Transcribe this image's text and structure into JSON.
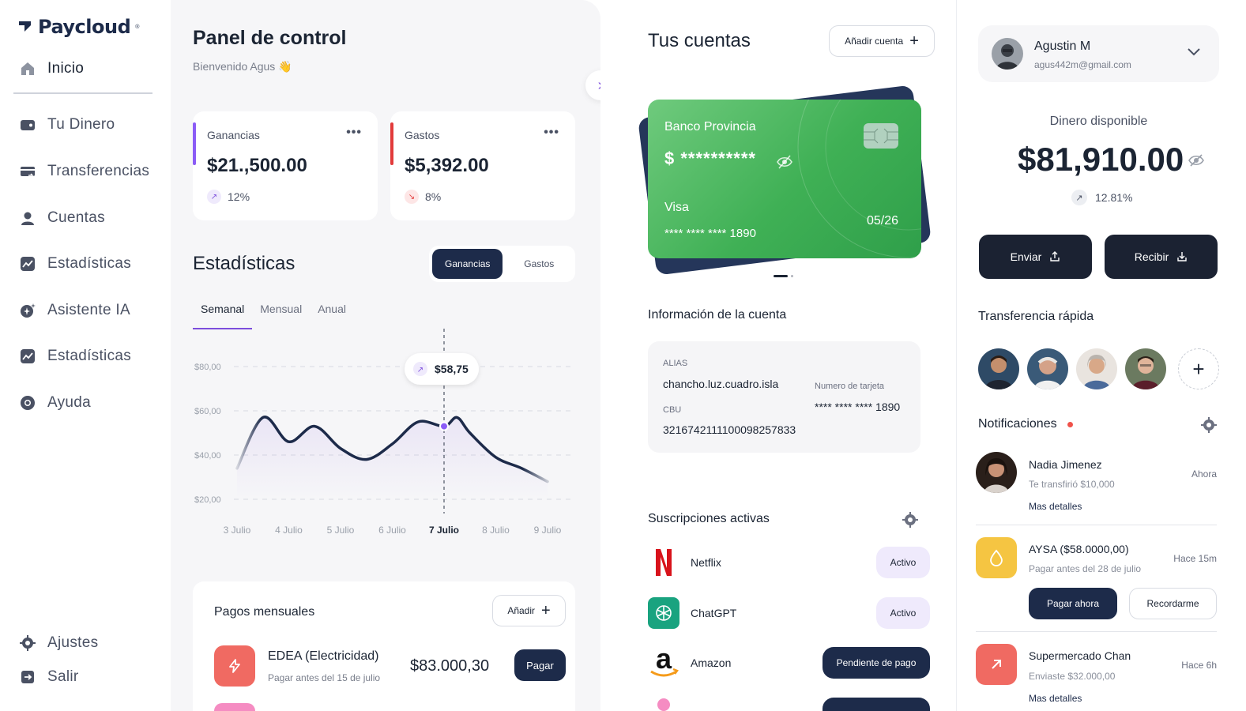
{
  "sidebar": {
    "brand": "Paycloud",
    "brand_mark": "®",
    "items": [
      {
        "label": "Inicio",
        "icon": "home-icon"
      },
      {
        "label": "Tu Dinero",
        "icon": "wallet-icon"
      },
      {
        "label": "Transferencias",
        "icon": "card-transfer-icon"
      },
      {
        "label": "Cuentas",
        "icon": "user-icon"
      },
      {
        "label": "Estadísticas",
        "icon": "chart-icon"
      },
      {
        "label": "Asistente IA",
        "icon": "sparkle-icon"
      },
      {
        "label": "Estadísticas",
        "icon": "chart-icon"
      },
      {
        "label": "Ayuda",
        "icon": "lifebuoy-icon"
      }
    ],
    "settings": "Ajustes",
    "logout": "Salir"
  },
  "dashboard": {
    "title": "Panel de control",
    "subtitle": "Bienvenido Agus 👋",
    "cards": [
      {
        "label": "Ganancias",
        "value": "$21.,500.00",
        "pct": "12%",
        "color": "#8b5cf6"
      },
      {
        "label": "Gastos",
        "value": "$5,392.00",
        "pct": "8%",
        "color": "#e23b3b"
      }
    ],
    "stats_title": "Estadísticas",
    "toggle": {
      "on": "Ganancias",
      "off": "Gastos"
    },
    "tabs": [
      "Semanal",
      "Mensual",
      "Anual"
    ],
    "tooltip": "$58,75"
  },
  "chart_data": {
    "type": "line",
    "categories": [
      "3 Julio",
      "4 Julio",
      "5 Julio",
      "6 Julio",
      "7 Julio",
      "8 Julio",
      "9 Julio"
    ],
    "ytick_labels": [
      "$80,00",
      "$60,00",
      "$40,00",
      "$20,00"
    ],
    "yticks": [
      80,
      60,
      40,
      20
    ],
    "x": [
      0,
      0.5,
      1,
      1.5,
      2,
      2.5,
      3,
      3.5,
      4,
      4.25,
      4.5,
      5,
      5.5,
      6
    ],
    "values": [
      34,
      57,
      46,
      53,
      43,
      38,
      45,
      55,
      53,
      57,
      50,
      39,
      34,
      28
    ],
    "highlight": {
      "category": "7 Julio",
      "value": 58.75
    },
    "ylim": [
      15,
      85
    ],
    "grid": true
  },
  "payments": {
    "title": "Pagos mensuales",
    "add": "Añadir",
    "item": {
      "name": "EDEA (Electricidad)",
      "due": "Pagar antes del 15 de julio",
      "amount": "$83.000,30",
      "action": "Pagar"
    }
  },
  "accounts": {
    "title": "Tus cuentas",
    "add": "Añadir cuenta",
    "card": {
      "bank": "Banco Provincia",
      "hidden": "$ **********",
      "brand": "Visa",
      "number": "**** **** **** 1890",
      "exp": "05/26"
    },
    "info_title": "Información de la cuenta",
    "alias_label": "ALIAS",
    "alias": "chancho.luz.cuadro.isla",
    "cbu_label": "CBU",
    "cbu": "3216742111100098257833",
    "card_label": "Numero de tarjeta",
    "card_number": "**** **** **** 1890",
    "subs_title": "Suscripciones activas",
    "subs": [
      {
        "name": "Netflix",
        "status": "Activo"
      },
      {
        "name": "ChatGPT",
        "status": "Activo"
      },
      {
        "name": "Amazon",
        "status": "Pendiente de pago"
      }
    ]
  },
  "right": {
    "user": {
      "name": "Agustin M",
      "email": "agus442m@gmail.com"
    },
    "avail_label": "Dinero disponible",
    "avail_value": "$81,910.00",
    "avail_pct": "12.81%",
    "send": "Enviar",
    "receive": "Recibir",
    "quick_title": "Transferencia rápida",
    "notif_title": "Notificaciones",
    "notifications": [
      {
        "name": "Nadia Jimenez",
        "desc": "Te transfirió $10,000",
        "time": "Ahora",
        "link": "Mas detalles"
      },
      {
        "name": "AYSA ($58.0000,00)",
        "desc": "Pagar antes del 28 de julio",
        "time": "Hace 15m",
        "primary": "Pagar ahora",
        "secondary": "Recordarme"
      },
      {
        "name": "Supermercado Chan",
        "desc": "Enviaste $32.000,00",
        "time": "Hace 6h",
        "link": "Mas detalles"
      }
    ]
  }
}
